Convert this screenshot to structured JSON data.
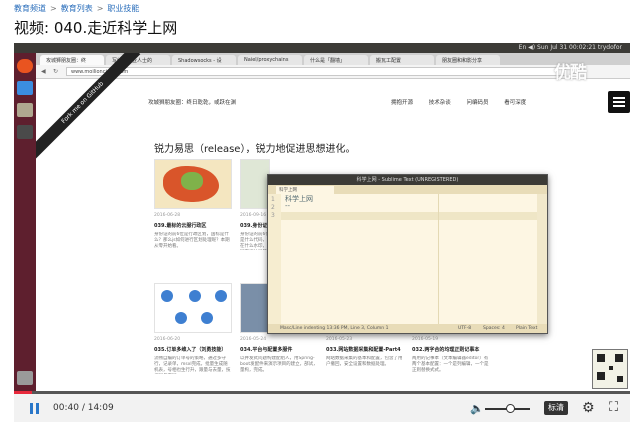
{
  "breadcrumb": {
    "items": [
      "教育频道",
      "教育列表",
      "职业技能"
    ],
    "separator": ">"
  },
  "page_title": "视频: 040.走近科学上网",
  "video": {
    "desktop": {
      "top_bar_text": "En  ◀)  Sun Jul 31  00:02:21  trydofor"
    },
    "browser": {
      "tabs": [
        "攻城狮朋友圈：终",
        "写给非专业人士的",
        "Shadowsocks - 设",
        "Naiel/proxychains",
        "什么是「翻墙」",
        "搬瓦工配置",
        "朋友圈和和影分享"
      ],
      "url": "www.moilioncircle.com",
      "ribbon_text": "Fork me on GitHub",
      "site_name": "攻城狮朋友圈：终日乾乾，或跃在渊",
      "site_nav": [
        "拥抱开源",
        "技术杂谈",
        "问编码员",
        "看可深度"
      ],
      "headline": "锐力易思（release），锐力地促进思想进化。",
      "cards": [
        {
          "date": "2016-06-28",
          "title": "039.最标的云服行政区",
          "desc": "身份证的前6位是行政区划，国标是什么？那么js如何进行区划处理呢？本期从零开始看。"
        },
        {
          "date": "2016-09-16",
          "title": "039.身份证",
          "desc": "身份证的前6位是什么代码，在什么水印，国家统计局等信息，下个实用。"
        },
        {
          "date": "2016-06-20",
          "title": "035.订单多维入了（刘勇技能）",
          "desc": "流畅自编的订单号的策略，通过多守行，记录单，msxl完成，批量生成随机表，号相也生行升，跟量与去量，技相同与不同。"
        },
        {
          "date": "2016-05-24",
          "title": "034.平台与配置多服件",
          "desc": "以并发式问题构建配组人，用Spring-boot发配件来演示项目的建立，部试，量构，完成。"
        },
        {
          "date": "2016-05-23",
          "title": "033.网站数据采集和配置-Part4",
          "desc": "网站数据采集的基本和配置，包含了用户撤回，安全设置和数据处理。"
        },
        {
          "date": "2016-05-19",
          "title": "032.两字合的均理正则记事本",
          "desc": "两用的记事本（文本编辑器editor）有两个基本配置：一个是列编辑，一个是正则替换式式。"
        }
      ]
    },
    "editor": {
      "window_title": "科学上网 - Sublime Text (UNREGISTERED)",
      "tab_label": "科学上网",
      "line_numbers": [
        "1",
        "2",
        "3"
      ],
      "lines": [
        "科学上网",
        "--",
        ""
      ],
      "status_left": "Masc/Line indenting 13:36 PM, Line 3, Column 1",
      "status_items": [
        "UTF-8",
        "Spaces: 4",
        "Plain Text"
      ]
    },
    "watermark": "优酷",
    "progress_fraction": 0.029
  },
  "controls": {
    "current_time": "00:40",
    "time_separator": "/",
    "duration": "14:09",
    "quality_label": "标清",
    "volume_fraction": 0.55
  },
  "colors": {
    "accent_blue": "#2a77c9",
    "progress_red": "#e8293c",
    "launcher": "#5e1f2e"
  }
}
